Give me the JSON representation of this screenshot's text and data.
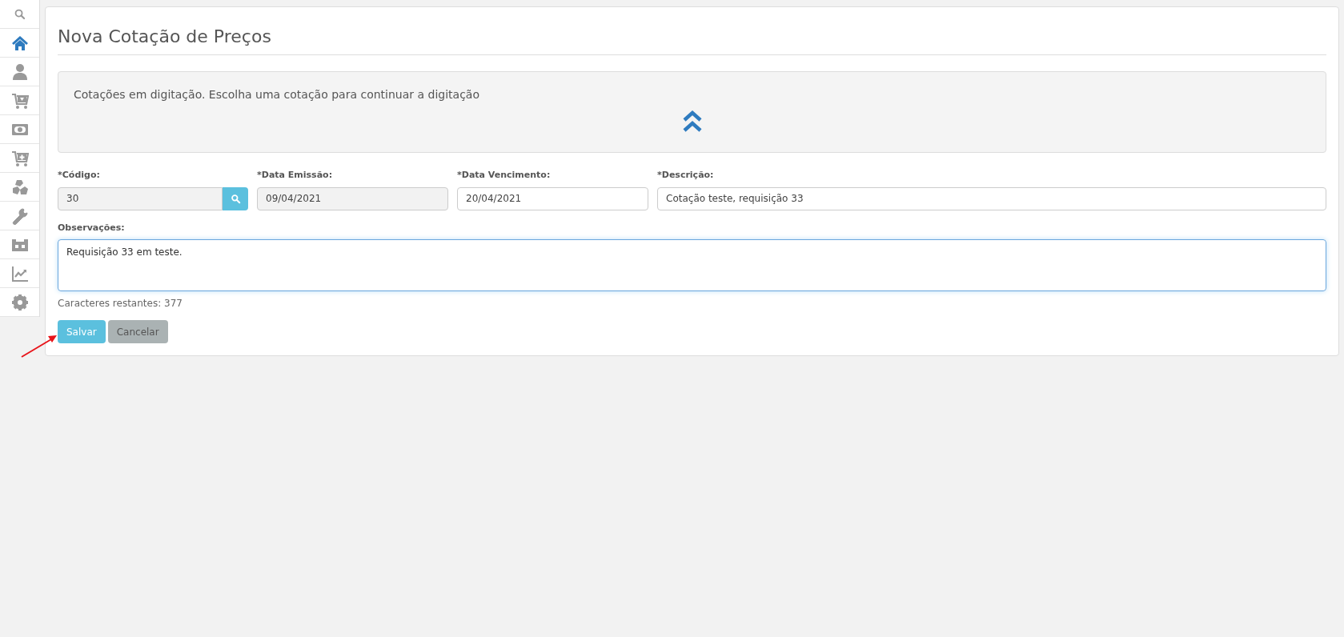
{
  "sidebar": {
    "items": [
      {
        "selected": false
      },
      {
        "selected": true
      },
      {
        "selected": false
      },
      {
        "selected": false
      },
      {
        "selected": false
      },
      {
        "selected": false
      },
      {
        "selected": false
      },
      {
        "selected": false
      },
      {
        "selected": false
      },
      {
        "selected": false
      },
      {
        "selected": false
      }
    ]
  },
  "page": {
    "title": "Nova Cotação de Preços",
    "info_panel": {
      "text": "Cotações em digitação. Escolha uma cotação para continuar a digitação"
    },
    "fields": [
      {
        "label": "*Código:",
        "value": "30",
        "disabled": true
      },
      {
        "label": "*Data Emissão:",
        "value": "09/04/2021",
        "disabled": true
      },
      {
        "label": "*Data Vencimento:",
        "value": "20/04/2021",
        "disabled": false
      },
      {
        "label": "*Descrição:",
        "value": "Cotação teste, requisição 33",
        "disabled": false
      }
    ],
    "notes": {
      "label": "Observações:",
      "value": "Requisição 33 em teste.",
      "counter": "Caracteres restantes: 377"
    },
    "buttons": [
      {
        "label": "Salvar",
        "kind": "primary"
      },
      {
        "label": "Cancelar",
        "kind": "secondary"
      }
    ]
  }
}
